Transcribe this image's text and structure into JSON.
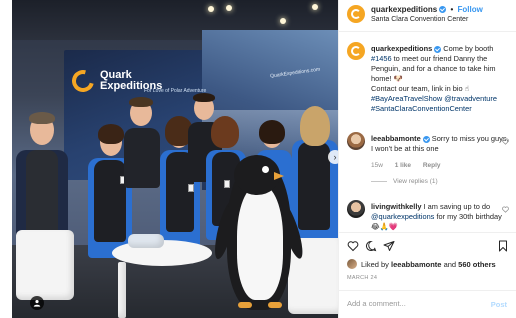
{
  "post": {
    "account": "quarkexpeditions",
    "follow_label": "Follow",
    "separator": "•",
    "location": "Santa Clara Convention Center"
  },
  "photo": {
    "logo_text_line1": "Quark",
    "logo_text_line2": "Expeditions",
    "tagline": "For Love of Polar Adventure",
    "booth_url": "QuarkExpeditions.com",
    "carousel_arrow": "›"
  },
  "caption": {
    "username": "quarkexpeditions",
    "text1": "Come by booth",
    "booth_tag": "#1456",
    "text2": "to meet our friend Danny the Penguin, and for a chance to take him home!",
    "line2": "Contact our team, link in bio",
    "tag1": "#BayAreaTravelShow",
    "mention": "@travadventure",
    "tag2": "#SantaClaraConventionCenter"
  },
  "comments": [
    {
      "username": "leeabbamonte",
      "text": "Sorry to miss you guys, I won't be at this one",
      "time": "15w",
      "likes": "1 like",
      "reply": "Reply",
      "view_replies": "View replies (1)"
    },
    {
      "username": "livingwithkelly",
      "text1": "I am saving up to do",
      "mention": "@quarkexpeditions",
      "text2": "for my 30th birthday",
      "emoji": "😂🙏💗"
    }
  ],
  "engagement": {
    "liked_by_prefix": "Liked by",
    "liked_by_user": "leeabbamonte",
    "liked_by_and": "and",
    "others": "560 others",
    "date": "MARCH 24"
  },
  "comment_box": {
    "placeholder": "Add a comment...",
    "post_label": "Post"
  },
  "icons": [
    "heart-icon",
    "comment-icon",
    "share-icon",
    "bookmark-icon",
    "verified-icon",
    "user-tag-icon",
    "chevron-right-icon"
  ],
  "colors": {
    "link": "#003569",
    "accent": "#3897f0",
    "brand": "#f5a623"
  }
}
